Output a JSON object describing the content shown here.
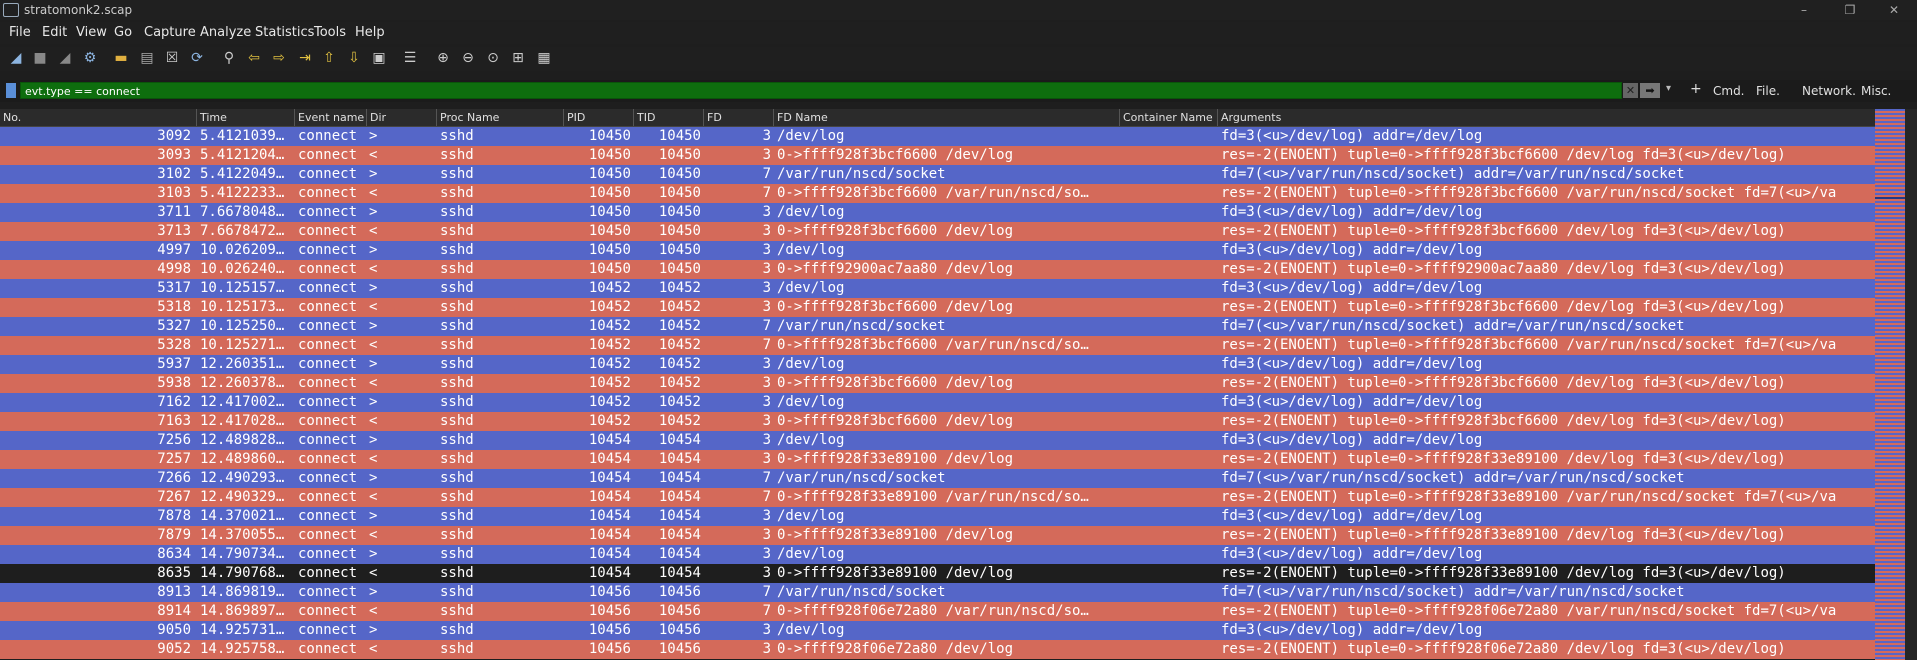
{
  "window": {
    "title": "stratomonk2.scap"
  },
  "menu": [
    "File",
    "Edit",
    "View",
    "Go",
    "Capture",
    "Analyze",
    "Statistics",
    "Tools",
    "Help"
  ],
  "filter": {
    "value": "evt.type == connect",
    "buttons": [
      "Cmd.",
      "File.",
      "Network.",
      "Misc."
    ]
  },
  "columns": [
    "No.",
    "Time",
    "Event name",
    "Dir",
    "Proc Name",
    "PID",
    "TID",
    "FD",
    "FD Name",
    "Container Name",
    "Arguments"
  ],
  "rows": [
    {
      "no": "3092",
      "time": "5.4121039…",
      "event": "connect",
      "dir": ">",
      "proc": "sshd",
      "pid": "10450",
      "tid": "10450",
      "fd": "3",
      "fdname": "/dev/log",
      "args": "fd=3(<u>/dev/log) addr=/dev/log",
      "color": "b"
    },
    {
      "no": "3093",
      "time": "5.4121204…",
      "event": "connect",
      "dir": "<",
      "proc": "sshd",
      "pid": "10450",
      "tid": "10450",
      "fd": "3",
      "fdname": "0->ffff928f3bcf6600 /dev/log",
      "args": "res=-2(ENOENT) tuple=0->ffff928f3bcf6600 /dev/log fd=3(<u>/dev/log)",
      "color": "r"
    },
    {
      "no": "3102",
      "time": "5.4122049…",
      "event": "connect",
      "dir": ">",
      "proc": "sshd",
      "pid": "10450",
      "tid": "10450",
      "fd": "7",
      "fdname": "/var/run/nscd/socket",
      "args": "fd=7(<u>/var/run/nscd/socket) addr=/var/run/nscd/socket",
      "color": "b"
    },
    {
      "no": "3103",
      "time": "5.4122233…",
      "event": "connect",
      "dir": "<",
      "proc": "sshd",
      "pid": "10450",
      "tid": "10450",
      "fd": "7",
      "fdname": "0->ffff928f3bcf6600 /var/run/nscd/so…",
      "args": "res=-2(ENOENT) tuple=0->ffff928f3bcf6600 /var/run/nscd/socket fd=7(<u>/va",
      "color": "r"
    },
    {
      "no": "3711",
      "time": "7.6678048…",
      "event": "connect",
      "dir": ">",
      "proc": "sshd",
      "pid": "10450",
      "tid": "10450",
      "fd": "3",
      "fdname": "/dev/log",
      "args": "fd=3(<u>/dev/log) addr=/dev/log",
      "color": "b"
    },
    {
      "no": "3713",
      "time": "7.6678472…",
      "event": "connect",
      "dir": "<",
      "proc": "sshd",
      "pid": "10450",
      "tid": "10450",
      "fd": "3",
      "fdname": "0->ffff928f3bcf6600 /dev/log",
      "args": "res=-2(ENOENT) tuple=0->ffff928f3bcf6600 /dev/log fd=3(<u>/dev/log)",
      "color": "r"
    },
    {
      "no": "4997",
      "time": "10.026209…",
      "event": "connect",
      "dir": ">",
      "proc": "sshd",
      "pid": "10450",
      "tid": "10450",
      "fd": "3",
      "fdname": "/dev/log",
      "args": "fd=3(<u>/dev/log) addr=/dev/log",
      "color": "b"
    },
    {
      "no": "4998",
      "time": "10.026240…",
      "event": "connect",
      "dir": "<",
      "proc": "sshd",
      "pid": "10450",
      "tid": "10450",
      "fd": "3",
      "fdname": "0->ffff92900ac7aa80 /dev/log",
      "args": "res=-2(ENOENT) tuple=0->ffff92900ac7aa80 /dev/log fd=3(<u>/dev/log)",
      "color": "r"
    },
    {
      "no": "5317",
      "time": "10.125157…",
      "event": "connect",
      "dir": ">",
      "proc": "sshd",
      "pid": "10452",
      "tid": "10452",
      "fd": "3",
      "fdname": "/dev/log",
      "args": "fd=3(<u>/dev/log) addr=/dev/log",
      "color": "b"
    },
    {
      "no": "5318",
      "time": "10.125173…",
      "event": "connect",
      "dir": "<",
      "proc": "sshd",
      "pid": "10452",
      "tid": "10452",
      "fd": "3",
      "fdname": "0->ffff928f3bcf6600 /dev/log",
      "args": "res=-2(ENOENT) tuple=0->ffff928f3bcf6600 /dev/log fd=3(<u>/dev/log)",
      "color": "r"
    },
    {
      "no": "5327",
      "time": "10.125250…",
      "event": "connect",
      "dir": ">",
      "proc": "sshd",
      "pid": "10452",
      "tid": "10452",
      "fd": "7",
      "fdname": "/var/run/nscd/socket",
      "args": "fd=7(<u>/var/run/nscd/socket) addr=/var/run/nscd/socket",
      "color": "b"
    },
    {
      "no": "5328",
      "time": "10.125271…",
      "event": "connect",
      "dir": "<",
      "proc": "sshd",
      "pid": "10452",
      "tid": "10452",
      "fd": "7",
      "fdname": "0->ffff928f3bcf6600 /var/run/nscd/so…",
      "args": "res=-2(ENOENT) tuple=0->ffff928f3bcf6600 /var/run/nscd/socket fd=7(<u>/va",
      "color": "r"
    },
    {
      "no": "5937",
      "time": "12.260351…",
      "event": "connect",
      "dir": ">",
      "proc": "sshd",
      "pid": "10452",
      "tid": "10452",
      "fd": "3",
      "fdname": "/dev/log",
      "args": "fd=3(<u>/dev/log) addr=/dev/log",
      "color": "b"
    },
    {
      "no": "5938",
      "time": "12.260378…",
      "event": "connect",
      "dir": "<",
      "proc": "sshd",
      "pid": "10452",
      "tid": "10452",
      "fd": "3",
      "fdname": "0->ffff928f3bcf6600 /dev/log",
      "args": "res=-2(ENOENT) tuple=0->ffff928f3bcf6600 /dev/log fd=3(<u>/dev/log)",
      "color": "r"
    },
    {
      "no": "7162",
      "time": "12.417002…",
      "event": "connect",
      "dir": ">",
      "proc": "sshd",
      "pid": "10452",
      "tid": "10452",
      "fd": "3",
      "fdname": "/dev/log",
      "args": "fd=3(<u>/dev/log) addr=/dev/log",
      "color": "b"
    },
    {
      "no": "7163",
      "time": "12.417028…",
      "event": "connect",
      "dir": "<",
      "proc": "sshd",
      "pid": "10452",
      "tid": "10452",
      "fd": "3",
      "fdname": "0->ffff928f3bcf6600 /dev/log",
      "args": "res=-2(ENOENT) tuple=0->ffff928f3bcf6600 /dev/log fd=3(<u>/dev/log)",
      "color": "r"
    },
    {
      "no": "7256",
      "time": "12.489828…",
      "event": "connect",
      "dir": ">",
      "proc": "sshd",
      "pid": "10454",
      "tid": "10454",
      "fd": "3",
      "fdname": "/dev/log",
      "args": "fd=3(<u>/dev/log) addr=/dev/log",
      "color": "b"
    },
    {
      "no": "7257",
      "time": "12.489860…",
      "event": "connect",
      "dir": "<",
      "proc": "sshd",
      "pid": "10454",
      "tid": "10454",
      "fd": "3",
      "fdname": "0->ffff928f33e89100 /dev/log",
      "args": "res=-2(ENOENT) tuple=0->ffff928f33e89100 /dev/log fd=3(<u>/dev/log)",
      "color": "r"
    },
    {
      "no": "7266",
      "time": "12.490293…",
      "event": "connect",
      "dir": ">",
      "proc": "sshd",
      "pid": "10454",
      "tid": "10454",
      "fd": "7",
      "fdname": "/var/run/nscd/socket",
      "args": "fd=7(<u>/var/run/nscd/socket) addr=/var/run/nscd/socket",
      "color": "b"
    },
    {
      "no": "7267",
      "time": "12.490329…",
      "event": "connect",
      "dir": "<",
      "proc": "sshd",
      "pid": "10454",
      "tid": "10454",
      "fd": "7",
      "fdname": "0->ffff928f33e89100 /var/run/nscd/so…",
      "args": "res=-2(ENOENT) tuple=0->ffff928f33e89100 /var/run/nscd/socket fd=7(<u>/va",
      "color": "r"
    },
    {
      "no": "7878",
      "time": "14.370021…",
      "event": "connect",
      "dir": ">",
      "proc": "sshd",
      "pid": "10454",
      "tid": "10454",
      "fd": "3",
      "fdname": "/dev/log",
      "args": "fd=3(<u>/dev/log) addr=/dev/log",
      "color": "b"
    },
    {
      "no": "7879",
      "time": "14.370055…",
      "event": "connect",
      "dir": "<",
      "proc": "sshd",
      "pid": "10454",
      "tid": "10454",
      "fd": "3",
      "fdname": "0->ffff928f33e89100 /dev/log",
      "args": "res=-2(ENOENT) tuple=0->ffff928f33e89100 /dev/log fd=3(<u>/dev/log)",
      "color": "r"
    },
    {
      "no": "8634",
      "time": "14.790734…",
      "event": "connect",
      "dir": ">",
      "proc": "sshd",
      "pid": "10454",
      "tid": "10454",
      "fd": "3",
      "fdname": "/dev/log",
      "args": "fd=3(<u>/dev/log) addr=/dev/log",
      "color": "b"
    },
    {
      "no": "8635",
      "time": "14.790768…",
      "event": "connect",
      "dir": "<",
      "proc": "sshd",
      "pid": "10454",
      "tid": "10454",
      "fd": "3",
      "fdname": "0->ffff928f33e89100 /dev/log",
      "args": "res=-2(ENOENT) tuple=0->ffff928f33e89100 /dev/log fd=3(<u>/dev/log)",
      "color": "s"
    },
    {
      "no": "8913",
      "time": "14.869819…",
      "event": "connect",
      "dir": ">",
      "proc": "sshd",
      "pid": "10456",
      "tid": "10456",
      "fd": "7",
      "fdname": "/var/run/nscd/socket",
      "args": "fd=7(<u>/var/run/nscd/socket) addr=/var/run/nscd/socket",
      "color": "b"
    },
    {
      "no": "8914",
      "time": "14.869897…",
      "event": "connect",
      "dir": "<",
      "proc": "sshd",
      "pid": "10456",
      "tid": "10456",
      "fd": "7",
      "fdname": "0->ffff928f06e72a80 /var/run/nscd/so…",
      "args": "res=-2(ENOENT) tuple=0->ffff928f06e72a80 /var/run/nscd/socket fd=7(<u>/va",
      "color": "r"
    },
    {
      "no": "9050",
      "time": "14.925731…",
      "event": "connect",
      "dir": ">",
      "proc": "sshd",
      "pid": "10456",
      "tid": "10456",
      "fd": "3",
      "fdname": "/dev/log",
      "args": "fd=3(<u>/dev/log) addr=/dev/log",
      "color": "b"
    },
    {
      "no": "9052",
      "time": "14.925758…",
      "event": "connect",
      "dir": "<",
      "proc": "sshd",
      "pid": "10456",
      "tid": "10456",
      "fd": "3",
      "fdname": "0->ffff928f06e72a80 /dev/log",
      "args": "res=-2(ENOENT) tuple=0->ffff928f06e72a80 /dev/log fd=3(<u>/dev/log)",
      "color": "r"
    }
  ]
}
